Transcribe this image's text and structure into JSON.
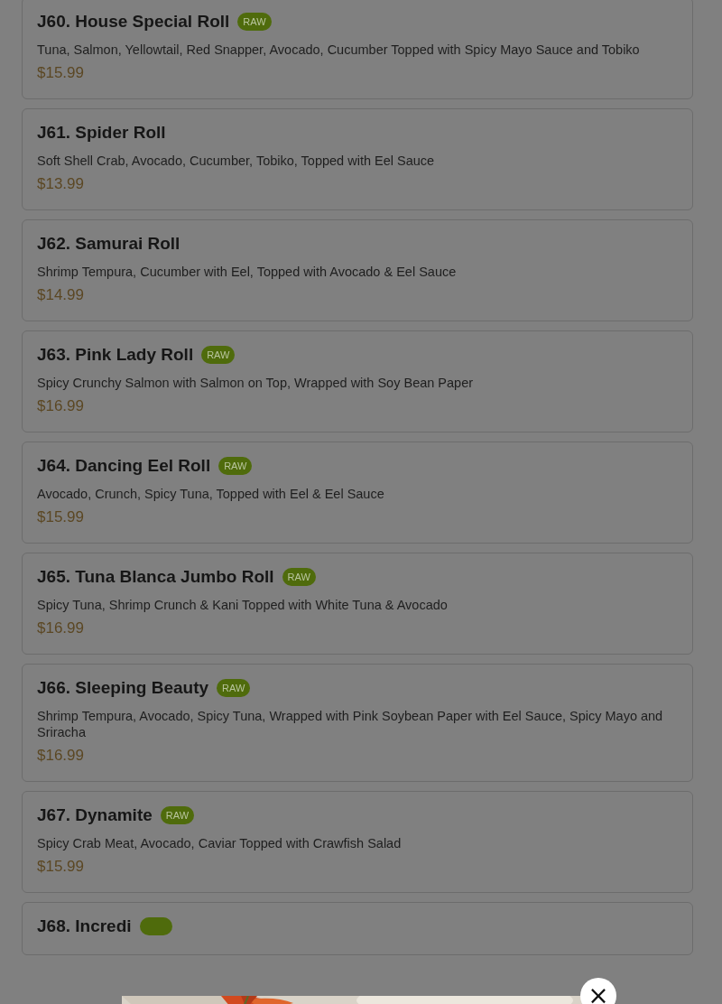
{
  "menu_items": [
    {
      "title": "J60. House Special Roll",
      "badge": "RAW",
      "description": "Tuna, Salmon, Yellowtail, Red Snapper, Avocado, Cucumber Topped with Spicy Mayo Sauce and Tobiko",
      "price": "$15.99"
    },
    {
      "title": "J61. Spider Roll",
      "description": "Soft Shell Crab, Avocado, Cucumber, Tobiko, Topped with Eel Sauce",
      "price": "$13.99"
    },
    {
      "title": "J62. Samurai Roll",
      "description": "Shrimp Tempura, Cucumber with Eel, Topped with Avocado & Eel Sauce",
      "price": "$14.99"
    },
    {
      "title": "J63. Pink Lady Roll",
      "badge": "RAW",
      "description": "Spicy Crunchy Salmon with Salmon on Top, Wrapped with Soy Bean Paper",
      "price": "$16.99"
    },
    {
      "title": "J64. Dancing Eel Roll",
      "badge": "RAW",
      "description": "Avocado, Crunch, Spicy Tuna, Topped with Eel & Eel Sauce",
      "price": "$15.99"
    },
    {
      "title": "J65. Tuna Blanca Jumbo Roll",
      "badge": "RAW",
      "description": "Spicy Tuna, Shrimp Crunch & Kani Topped with White Tuna & Avocado",
      "price": "$16.99"
    },
    {
      "title": "J66. Sleeping Beauty",
      "badge": "RAW",
      "description": "Shrimp Tempura, Avocado, Spicy Tuna, Wrapped with Pink Soybean Paper with Eel Sauce, Spicy Mayo and Sriracha",
      "price": "$16.99"
    },
    {
      "title": "J67. Dynamite",
      "badge": "RAW",
      "description": "Spicy Crab Meat, Avocado, Caviar Topped with Crawfish Salad",
      "price": "$15.99"
    },
    {
      "title": "J68. Incredi",
      "kind": "cut"
    }
  ],
  "modal": {
    "close": "×"
  }
}
